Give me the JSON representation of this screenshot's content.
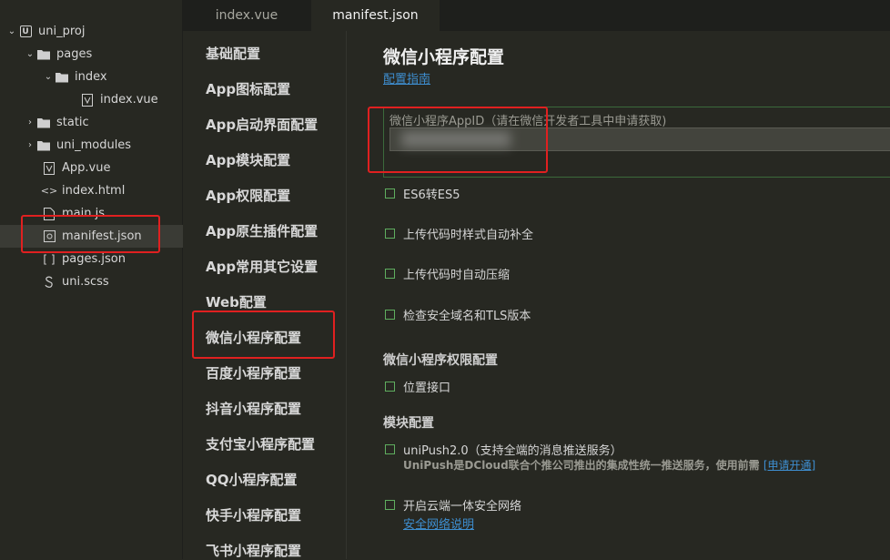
{
  "tree": {
    "items": [
      {
        "label": "uni_proj",
        "icon": "project-icon",
        "chevron": "down"
      },
      {
        "label": "pages",
        "icon": "folder-open-icon",
        "chevron": "down"
      },
      {
        "label": "index",
        "icon": "folder-open-icon",
        "chevron": "down"
      },
      {
        "label": "index.vue",
        "icon": "vue-file-icon",
        "chevron": ""
      },
      {
        "label": "static",
        "icon": "folder-icon",
        "chevron": "right"
      },
      {
        "label": "uni_modules",
        "icon": "folder-icon",
        "chevron": "right"
      },
      {
        "label": "App.vue",
        "icon": "vue-file-icon",
        "chevron": ""
      },
      {
        "label": "index.html",
        "icon": "html-file-icon",
        "chevron": ""
      },
      {
        "label": "main.js",
        "icon": "js-file-icon",
        "chevron": ""
      },
      {
        "label": "manifest.json",
        "icon": "settings-file-icon",
        "chevron": ""
      },
      {
        "label": "pages.json",
        "icon": "json-file-icon",
        "chevron": ""
      },
      {
        "label": "uni.scss",
        "icon": "scss-file-icon",
        "chevron": ""
      }
    ]
  },
  "tabs": [
    {
      "label": "index.vue"
    },
    {
      "label": "manifest.json"
    }
  ],
  "nav": {
    "items": [
      "基础配置",
      "App图标配置",
      "App启动界面配置",
      "App模块配置",
      "App权限配置",
      "App原生插件配置",
      "App常用其它设置",
      "Web配置",
      "微信小程序配置",
      "百度小程序配置",
      "抖音小程序配置",
      "支付宝小程序配置",
      "QQ小程序配置",
      "快手小程序配置",
      "飞书小程序配置"
    ]
  },
  "content": {
    "title": "微信小程序配置",
    "guide_link": "配置指南",
    "appid_label": "微信小程序AppID（请在微信开发者工具中申请获取)",
    "appid_value": "",
    "options": [
      "ES6转ES5",
      "上传代码时样式自动补全",
      "上传代码时自动压缩",
      "检查安全域名和TLS版本"
    ],
    "perm_title": "微信小程序权限配置",
    "perm_option": "位置接口",
    "module_title": "模块配置",
    "unipush_label": "uniPush2.0（支持全端的消息推送服务）",
    "unipush_note": "UniPush是DCloud联合个推公司推出的集成性统一推送服务，使用前需",
    "unipush_link": "[申请开通]",
    "secure_label": "开启云端一体安全网络",
    "secure_link": "安全网络说明"
  },
  "colors": {
    "background": "#272822",
    "link": "#3e8ed0",
    "checkbox": "#5fae5f",
    "annotation": "#e02020"
  }
}
